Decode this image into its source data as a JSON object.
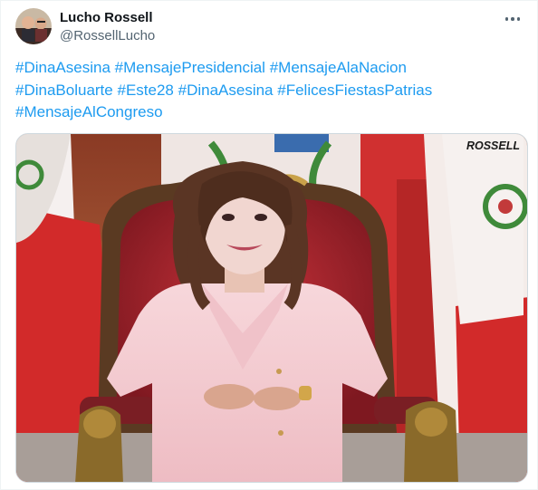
{
  "author": {
    "name": "Lucho Rossell",
    "handle": "@RossellLucho"
  },
  "menu": {
    "icon": "more-horizontal-icon"
  },
  "tweet": {
    "lines": [
      [
        "#DinaAsesina",
        "#MensajePresidencial",
        "#MensajeAlaNacion"
      ],
      [
        "#DinaBoluarte",
        "#Este28",
        "#DinaAsesina",
        "#FelicesFiestasPatrias"
      ],
      [
        "#MensajeAlCongreso"
      ]
    ]
  },
  "media": {
    "watermark": "ROSSELL"
  },
  "colors": {
    "link": "#1d9bf0",
    "name": "#0f1419",
    "muted": "#536471",
    "flag_red": "#d22a2a",
    "suit_pink": "#f4c9cf",
    "chair_red": "#a3212a"
  }
}
